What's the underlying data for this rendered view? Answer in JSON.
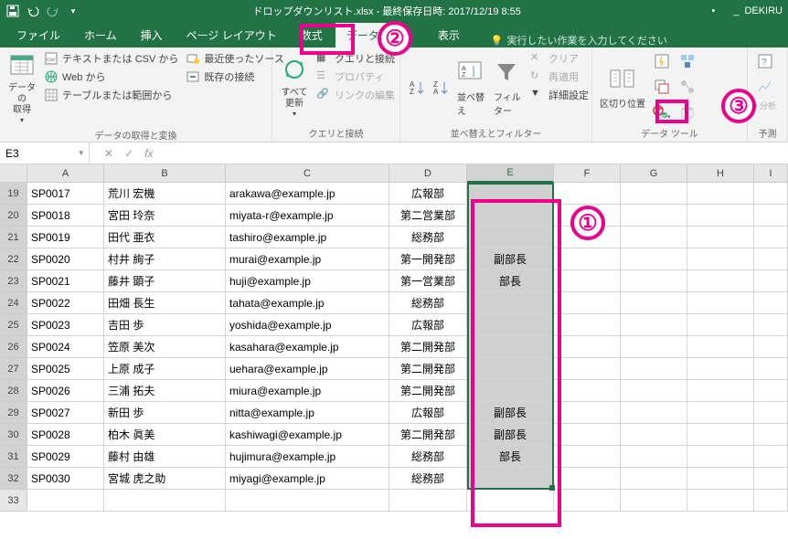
{
  "titlebar": {
    "title": "ドロップダウンリスト.xlsx - 最終保存日時: 2017/12/19 8:55",
    "user": "DEKIRU"
  },
  "tabs": {
    "file": "ファイル",
    "home": "ホーム",
    "insert": "挿入",
    "layout": "ページ レイアウト",
    "formulas": "数式",
    "data": "データ",
    "view": "表示",
    "tellme": "実行したい作業を入力してください"
  },
  "ribbon": {
    "g1": {
      "main": "データの\n取得",
      "r1": "テキストまたは CSV から",
      "r2": "Web から",
      "r3": "テーブルまたは範囲から",
      "r4": "最近使ったソース",
      "r5": "既存の接続",
      "label": "データの取得と変換"
    },
    "g2": {
      "main": "すべて\n更新",
      "r1": "クエリと接続",
      "r2": "プロパティ",
      "r3": "リンクの編集",
      "label": "クエリと接続"
    },
    "g3": {
      "sort": "並べ替え",
      "filter": "フィルター",
      "r1": "クリア",
      "r2": "再適用",
      "r3": "詳細設定",
      "label": "並べ替えとフィルター"
    },
    "g4": {
      "split": "区切り位置",
      "label": "データ ツール"
    },
    "g5": {
      "label": "予測",
      "btn": "分析"
    }
  },
  "namebox": "E3",
  "columns": [
    "A",
    "B",
    "C",
    "D",
    "E",
    "F",
    "G",
    "H",
    "I"
  ],
  "rowStart": 19,
  "rows": [
    {
      "n": 19,
      "a": "SP0017",
      "b": "荒川 宏機",
      "c": "arakawa@example.jp",
      "d": "広報部",
      "e": ""
    },
    {
      "n": 20,
      "a": "SP0018",
      "b": "宮田 玲奈",
      "c": "miyata-r@example.jp",
      "d": "第二営業部",
      "e": ""
    },
    {
      "n": 21,
      "a": "SP0019",
      "b": "田代 亜衣",
      "c": "tashiro@example.jp",
      "d": "総務部",
      "e": ""
    },
    {
      "n": 22,
      "a": "SP0020",
      "b": "村井 絢子",
      "c": "murai@example.jp",
      "d": "第一開発部",
      "e": "副部長"
    },
    {
      "n": 23,
      "a": "SP0021",
      "b": "藤井 顕子",
      "c": "huji@example.jp",
      "d": "第一営業部",
      "e": "部長"
    },
    {
      "n": 24,
      "a": "SP0022",
      "b": "田畑 長生",
      "c": "tahata@example.jp",
      "d": "総務部",
      "e": ""
    },
    {
      "n": 25,
      "a": "SP0023",
      "b": "吉田 歩",
      "c": "yoshida@example.jp",
      "d": "広報部",
      "e": ""
    },
    {
      "n": 26,
      "a": "SP0024",
      "b": "笠原 美次",
      "c": "kasahara@example.jp",
      "d": "第二開発部",
      "e": ""
    },
    {
      "n": 27,
      "a": "SP0025",
      "b": "上原 成子",
      "c": "uehara@example.jp",
      "d": "第二開発部",
      "e": ""
    },
    {
      "n": 28,
      "a": "SP0026",
      "b": "三浦 拓夫",
      "c": "miura@example.jp",
      "d": "第二開発部",
      "e": ""
    },
    {
      "n": 29,
      "a": "SP0027",
      "b": "新田 歩",
      "c": "nitta@example.jp",
      "d": "広報部",
      "e": "副部長"
    },
    {
      "n": 30,
      "a": "SP0028",
      "b": "柏木 眞美",
      "c": "kashiwagi@example.jp",
      "d": "第二開発部",
      "e": "副部長"
    },
    {
      "n": 31,
      "a": "SP0029",
      "b": "藤村 由雄",
      "c": "hujimura@example.jp",
      "d": "総務部",
      "e": "部長"
    },
    {
      "n": 32,
      "a": "SP0030",
      "b": "宮城 虎之助",
      "c": "miyagi@example.jp",
      "d": "総務部",
      "e": ""
    },
    {
      "n": 33,
      "a": "",
      "b": "",
      "c": "",
      "d": "",
      "e": ""
    }
  ],
  "callouts": {
    "one": "①",
    "two": "②",
    "three": "③"
  }
}
